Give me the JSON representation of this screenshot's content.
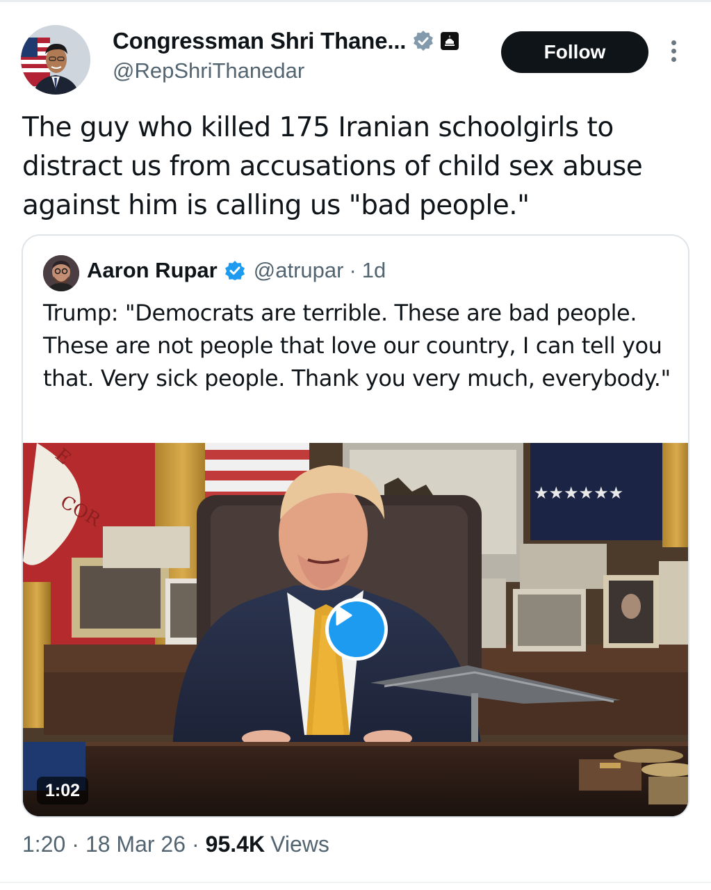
{
  "author": {
    "display_name": "Congressman Shri Thane...",
    "handle": "@RepShriThanedar",
    "avatar_icon": "profile-photo",
    "badges": [
      "gov-verified-icon",
      "capitol-icon"
    ]
  },
  "follow_label": "Follow",
  "more_icon": "more-vertical-icon",
  "tweet_text": "The guy who killed 175 Iranian schoolgirls to distract us from accusations of child sex abuse against him is calling us \"bad people.\"",
  "quoted": {
    "display_name": "Aaron Rupar",
    "handle": "@atrupar",
    "separator": "·",
    "time": "1d",
    "text": "Trump: \"Democrats are terrible. These are bad people. These are not people that love our country, I can tell you that. Very sick people. Thank you very much, everybody.\"",
    "video": {
      "duration": "1:02",
      "play_icon": "play-icon"
    }
  },
  "meta": {
    "time": "1:20",
    "date": "18 Mar 26",
    "dot": "·",
    "views_count": "95.4K",
    "views_label": "Views"
  },
  "colors": {
    "accent": "#1d9bf0",
    "text": "#0f1419",
    "secondary": "#536471",
    "gov_badge": "#829aab"
  }
}
